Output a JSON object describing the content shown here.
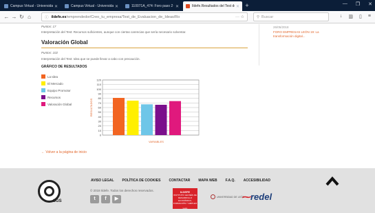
{
  "browser": {
    "tabs": [
      {
        "label": "Campus Virtual - Universidad I",
        "active": false
      },
      {
        "label": "Campus Virtual - Universidad I",
        "active": false
      },
      {
        "label": "110071A_474: Foro paso 2 Ord",
        "active": false
      },
      {
        "label": "Ildefe.Resultados del Test de C",
        "active": true
      }
    ],
    "url_domain": "ildefe.es",
    "url_rest": "/emprendedor/Creo_tu_empresa/Test_de_Evaluacion_de_Ideas/Ro",
    "search_placeholder": "Buscar"
  },
  "main": {
    "prev_score": "Puntos: 17",
    "prev_interpretation": "Interpretación del Test: Recursos suficientes, aunque con ciertas carencias que sería necesario solventar.",
    "section_title": "Valoración Global",
    "score": "Puntos: 102",
    "interpretation": "Interpretación del Test: Idea que se puede llevar a cabo con precaución.",
    "chart_heading": "GRÁFICO DE RESULTADOS",
    "back_link": "Volver a la página de inicio"
  },
  "sidebar": {
    "date": "26/05/2018",
    "link": "FORO EMPRESAS LEÓN 19: La transformación digital..."
  },
  "chart_data": {
    "type": "bar",
    "categories": [
      "La Idea",
      "El Mercado",
      "Equipo Promotor",
      "Recursos",
      "Valoración Global"
    ],
    "values": [
      81,
      75,
      67,
      66,
      74
    ],
    "colors": [
      "#f26522",
      "#ffef00",
      "#6ec6e8",
      "#7b0f8c",
      "#e0197d"
    ],
    "ylabel": "RESULTADOS",
    "xlabel": "VARIABLES",
    "yticks": [
      "0",
      "10",
      "20",
      "30",
      "40",
      "50",
      "60",
      "70",
      "80",
      "90",
      "100",
      "110",
      "120"
    ],
    "ylim": [
      0,
      120
    ],
    "legend": "left",
    "grid": true
  },
  "footer": {
    "links": [
      "AVISO LEGAL",
      "POLÍTICA DE COOKIES",
      "CONTACTAR",
      "MAPA WEB",
      "F.A.Q.",
      "ACCESIBILIDAD"
    ],
    "copyright": "© 2018 Ildefe. Todos los derechos reservados.",
    "certifier": "SGS",
    "red_logo_title": "ILDEFE",
    "red_logo_text": "INSTITUTO LEONÉS DE DESARROLLO ECONÓMICO, FORMACIÓN Y EMPLEO",
    "red_logo_city": "León",
    "university": "UNIVERSIDAD DE LEÓN",
    "network_logo": "redel"
  }
}
